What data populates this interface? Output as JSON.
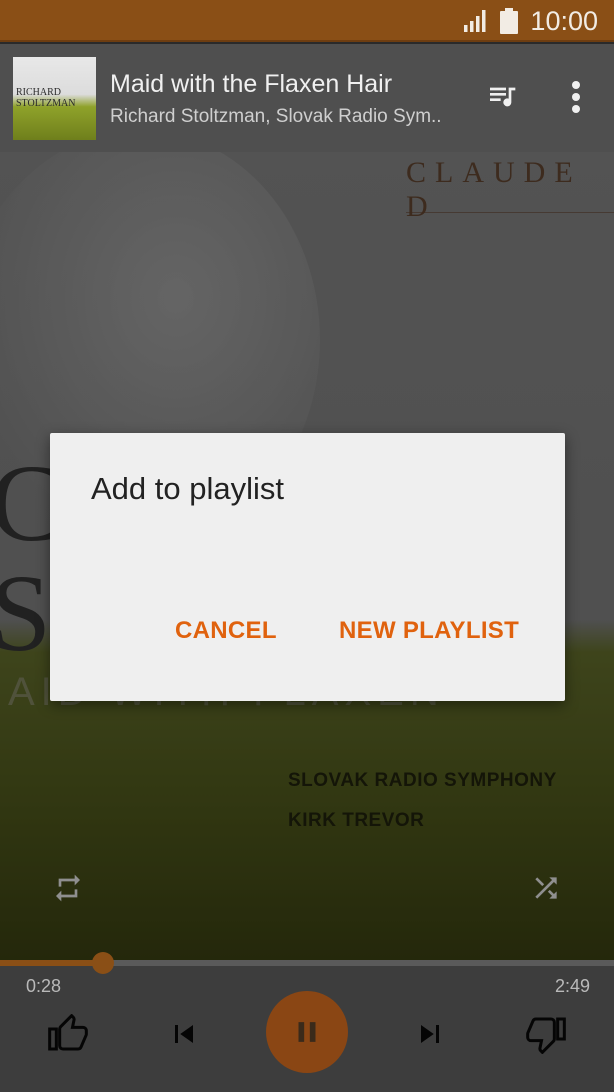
{
  "status_bar": {
    "time": "10:00",
    "icons": [
      "signal-icon",
      "battery-icon"
    ]
  },
  "now_playing": {
    "title": "Maid with the Flaxen Hair",
    "artist": "Richard Stoltzman, Slovak Radio Sym..",
    "album_thumb_text": "RICHARD STOLTZMAN",
    "icons": [
      "queue-music-icon",
      "more-vert-icon"
    ]
  },
  "album_art": {
    "top_text": "CLAUDE D",
    "big_letters": [
      "C",
      "S"
    ],
    "band_text": "AID WITH FLAXEN",
    "credits": [
      "SLOVAK RADIO SYMPHONY",
      "KIRK TREVOR"
    ]
  },
  "playback": {
    "elapsed": "0:28",
    "total": "2:49",
    "progress_fraction": 0.168,
    "icons": [
      "repeat-icon",
      "shuffle-icon",
      "thumbs-up-icon",
      "skip-previous-icon",
      "pause-icon",
      "skip-next-icon",
      "thumbs-down-icon"
    ]
  },
  "dialog": {
    "title": "Add to playlist",
    "cancel_label": "CANCEL",
    "new_playlist_label": "NEW PLAYLIST"
  },
  "colors": {
    "status_bar": "#8a4f16",
    "accent": "#e0620e",
    "play_button": "#8a4614"
  }
}
